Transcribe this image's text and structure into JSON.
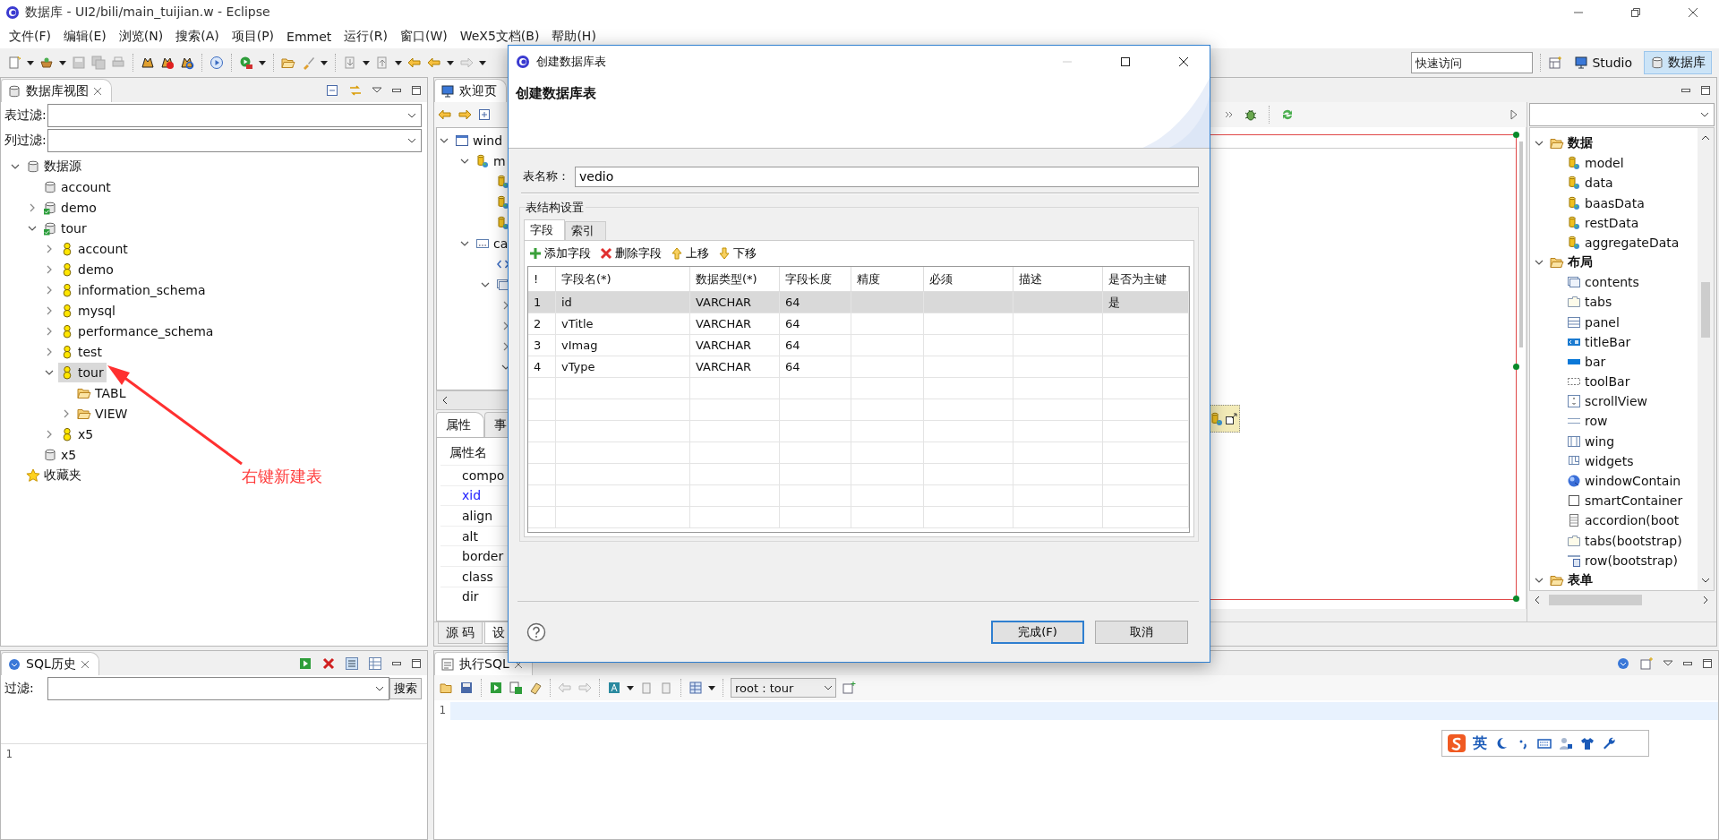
{
  "window": {
    "title": "数据库 - UI2/bili/main_tuijian.w - Eclipse"
  },
  "menu": [
    "文件(F)",
    "编辑(E)",
    "浏览(N)",
    "搜索(A)",
    "项目(P)",
    "Emmet",
    "运行(R)",
    "窗口(W)",
    "WeX5文档(B)",
    "帮助(H)"
  ],
  "quick_access": {
    "placeholder": "快速访问"
  },
  "perspectives": [
    {
      "label": "Studio",
      "kind": "studio",
      "selected": false
    },
    {
      "label": "数据库",
      "kind": "database",
      "selected": true
    }
  ],
  "db_view": {
    "title": "数据库视图",
    "filters": [
      {
        "label": "表过滤:"
      },
      {
        "label": "列过滤:"
      }
    ],
    "tree": [
      {
        "label": "数据源",
        "kind": "db",
        "expanded": true,
        "selected": false,
        "children": [
          {
            "label": "account",
            "kind": "db",
            "selected": false
          },
          {
            "label": "demo",
            "kind": "db-ok",
            "expanded": false,
            "selected": false
          },
          {
            "label": "tour",
            "kind": "db-ok",
            "expanded": true,
            "selected": false,
            "children": [
              {
                "label": "account",
                "kind": "schema",
                "expanded": false,
                "selected": false
              },
              {
                "label": "demo",
                "kind": "schema",
                "expanded": false,
                "selected": false
              },
              {
                "label": "information_schema",
                "kind": "schema",
                "expanded": false,
                "selected": false
              },
              {
                "label": "mysql",
                "kind": "schema",
                "expanded": false,
                "selected": false
              },
              {
                "label": "performance_schema",
                "kind": "schema",
                "expanded": false,
                "selected": false
              },
              {
                "label": "test",
                "kind": "schema",
                "expanded": false,
                "selected": false
              },
              {
                "label": "tour",
                "kind": "schema",
                "expanded": true,
                "selected": true,
                "children": [
                  {
                    "label": "TABL",
                    "kind": "folder",
                    "selected": false
                  },
                  {
                    "label": "VIEW",
                    "kind": "folder",
                    "expanded": false,
                    "selected": false
                  }
                ]
              },
              {
                "label": "x5",
                "kind": "schema",
                "expanded": false,
                "selected": false
              }
            ]
          },
          {
            "label": "x5",
            "kind": "db",
            "selected": false
          }
        ]
      },
      {
        "label": "收藏夹",
        "kind": "star",
        "selected": false
      }
    ]
  },
  "annotation": {
    "text": "右键新建表"
  },
  "editor": {
    "tab": "欢迎页",
    "outline": [
      {
        "label": "wind",
        "kind": "window",
        "expanded": true,
        "children": [
          {
            "label": "m",
            "kind": "model",
            "expanded": true,
            "children": [
              {
                "kind": "model"
              },
              {
                "kind": "model"
              },
              {
                "kind": "model"
              }
            ]
          },
          {
            "label": "ca",
            "kind": "container",
            "expanded": true,
            "children": [
              {
                "kind": "code"
              },
              {
                "kind": "contents",
                "expanded": true,
                "children": [
                  {
                    "expanded": false
                  },
                  {
                    "expanded": false
                  },
                  {
                    "expanded": false
                  },
                  {
                    "expanded": true
                  }
                ]
              }
            ]
          }
        ]
      }
    ],
    "properties": {
      "tabs": [
        {
          "label": "属性",
          "selected": true
        },
        {
          "label": "事",
          "selected": false
        }
      ],
      "header": "属性名",
      "rows": [
        {
          "name": "compo",
          "highlighted": false
        },
        {
          "name": "xid",
          "highlighted": true
        },
        {
          "name": "align",
          "highlighted": false
        },
        {
          "name": "alt",
          "highlighted": false
        },
        {
          "name": "border",
          "highlighted": false
        },
        {
          "name": "class",
          "highlighted": false
        },
        {
          "name": "dir",
          "highlighted": false
        }
      ]
    },
    "page_tabs": [
      {
        "label": "源 码",
        "selected": false
      },
      {
        "label": "设",
        "selected": true
      }
    ],
    "palette": [
      {
        "label": "数据",
        "kind": "folder",
        "expanded": true,
        "children": [
          {
            "label": "model",
            "kind": "model"
          },
          {
            "label": "data",
            "kind": "model"
          },
          {
            "label": "baasData",
            "kind": "model"
          },
          {
            "label": "restData",
            "kind": "model"
          },
          {
            "label": "aggregateData",
            "kind": "model"
          }
        ]
      },
      {
        "label": "布局",
        "kind": "folder",
        "expanded": true,
        "children": [
          {
            "label": "contents",
            "kind": "contents"
          },
          {
            "label": "tabs",
            "kind": "tabs"
          },
          {
            "label": "panel",
            "kind": "panel"
          },
          {
            "label": "titleBar",
            "kind": "titlebar"
          },
          {
            "label": "bar",
            "kind": "bar"
          },
          {
            "label": "toolBar",
            "kind": "toolbar"
          },
          {
            "label": "scrollView",
            "kind": "scroll"
          },
          {
            "label": "row",
            "kind": "row"
          },
          {
            "label": "wing",
            "kind": "wing"
          },
          {
            "label": "widgets",
            "kind": "widgets"
          },
          {
            "label": "windowContain",
            "kind": "sphere"
          },
          {
            "label": "smartContainer",
            "kind": "box"
          },
          {
            "label": "accordion(boot",
            "kind": "accordion"
          },
          {
            "label": "tabs(bootstrap)",
            "kind": "tabs"
          },
          {
            "label": "row(bootstrap)",
            "kind": "rowbs"
          }
        ]
      },
      {
        "label": "表单",
        "kind": "folder",
        "expanded": true
      }
    ]
  },
  "sql_history": {
    "title": "SQL历史",
    "filter_label": "过滤:",
    "search_button": "搜索",
    "line_numbers": [
      "1"
    ]
  },
  "exec_sql": {
    "title": "执行SQL",
    "connection": "root : tour",
    "line_numbers": [
      "1"
    ]
  },
  "ime": {
    "label": "英"
  },
  "dialog": {
    "title": "创建数据库表",
    "heading": "创建数据库表",
    "name_label": "表名称：",
    "name_value": "vedio",
    "group_label": "表结构设置",
    "tabs": [
      {
        "label": "字段",
        "selected": true
      },
      {
        "label": "索引",
        "selected": false
      }
    ],
    "actions": [
      {
        "label": "添加字段",
        "kind": "add"
      },
      {
        "label": "删除字段",
        "kind": "delete"
      },
      {
        "label": "上移",
        "kind": "up"
      },
      {
        "label": "下移",
        "kind": "down"
      }
    ],
    "columns": [
      "!",
      "字段名(*)",
      "数据类型(*)",
      "字段长度",
      "精度",
      "必须",
      "描述",
      "是否为主键"
    ],
    "rows": [
      {
        "cells": [
          "1",
          "id",
          "VARCHAR",
          "64"
        ],
        "primary_key": "是",
        "selected": true
      },
      {
        "cells": [
          "2",
          "vTitle",
          "VARCHAR",
          "64"
        ],
        "selected": false
      },
      {
        "cells": [
          "3",
          "vImag",
          "VARCHAR",
          "64"
        ],
        "selected": false
      },
      {
        "cells": [
          "4",
          "vType",
          "VARCHAR",
          "64"
        ],
        "selected": false
      }
    ],
    "buttons": [
      {
        "label": "完成(F)",
        "default": true
      },
      {
        "label": "取消",
        "default": false
      }
    ]
  }
}
